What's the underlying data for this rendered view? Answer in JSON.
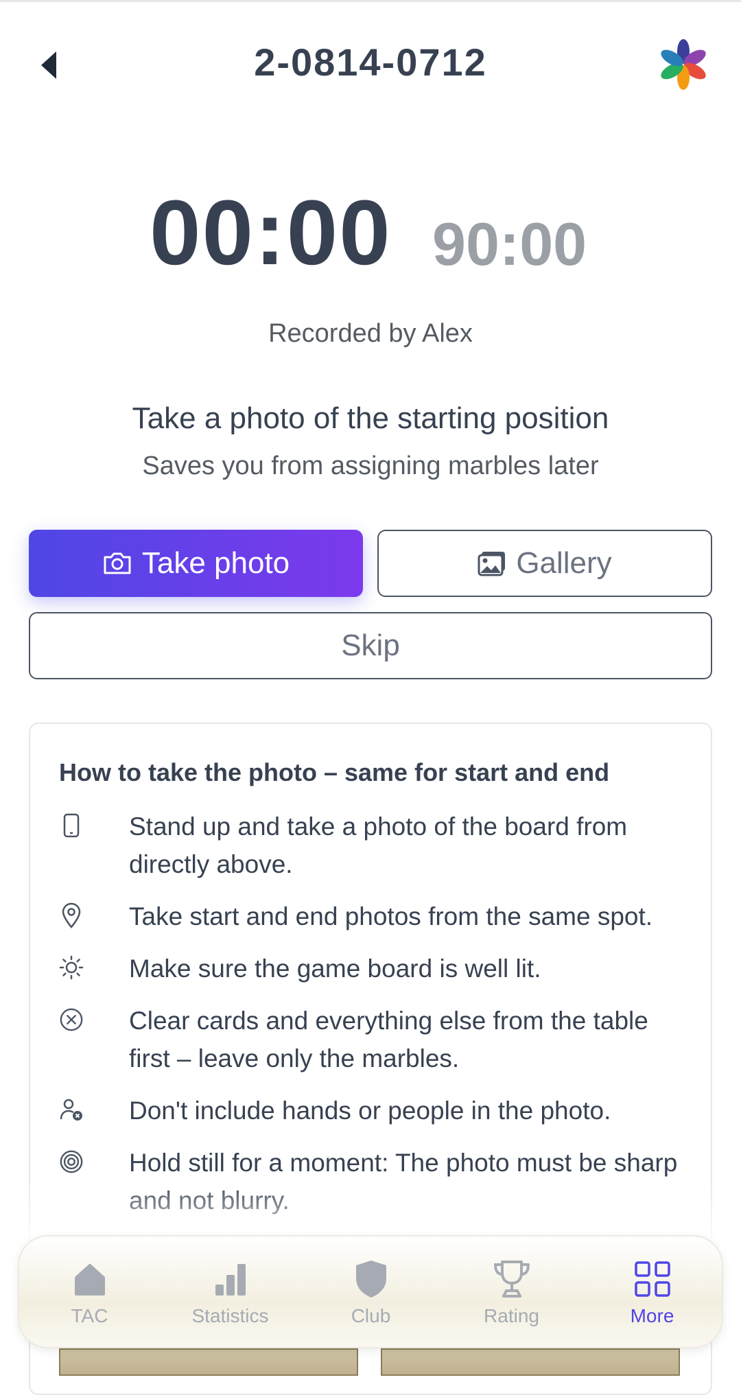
{
  "header": {
    "title": "2-0814-0712",
    "back_icon": "back-arrow-icon",
    "logo_icon": "flower-logo-icon"
  },
  "timers": {
    "elapsed": "00:00",
    "limit": "90:00"
  },
  "recorded_by": "Recorded by Alex",
  "prompt": {
    "heading": "Take a photo of the starting position",
    "subheading": "Saves you from assigning marbles later"
  },
  "actions": {
    "take_photo": "Take photo",
    "gallery": "Gallery",
    "skip": "Skip"
  },
  "instructions": {
    "title": "How to take the photo – same for start and end",
    "tips": [
      {
        "icon": "phone-icon",
        "text": "Stand up and take a photo of the board from directly above."
      },
      {
        "icon": "location-pin-icon",
        "text": "Take start and end photos from the same spot."
      },
      {
        "icon": "sun-icon",
        "text": "Make sure the game board is well lit."
      },
      {
        "icon": "circle-x-icon",
        "text": "Clear cards and everything else from the table first – leave only the marbles."
      },
      {
        "icon": "user-x-icon",
        "text": "Don't include hands or people in the photo."
      },
      {
        "icon": "target-icon",
        "text": "Hold still for a moment: The photo must be sharp and not blurry."
      }
    ]
  },
  "nav": {
    "items": [
      {
        "label": "TAC",
        "icon": "home-icon"
      },
      {
        "label": "Statistics",
        "icon": "bar-chart-icon"
      },
      {
        "label": "Club",
        "icon": "shield-icon"
      },
      {
        "label": "Rating",
        "icon": "trophy-icon"
      },
      {
        "label": "More",
        "icon": "grid-icon",
        "active": true
      }
    ]
  },
  "colors": {
    "accent": "#4f46e5",
    "accent_end": "#7c3aed",
    "text_dark": "#374151",
    "text_muted": "#9aa0a6"
  }
}
